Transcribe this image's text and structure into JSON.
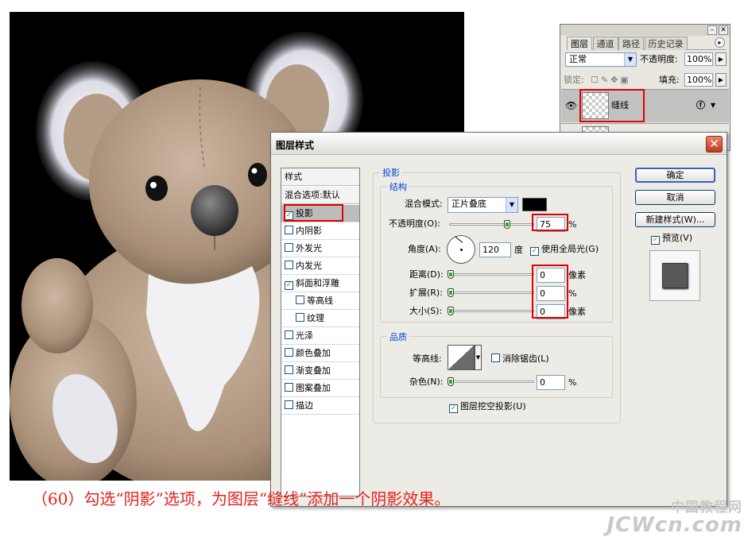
{
  "layers_panel": {
    "tabs": [
      {
        "label": "图层",
        "active": true
      },
      {
        "label": "通道"
      },
      {
        "label": "路径"
      },
      {
        "label": "历史记录"
      }
    ],
    "blend_mode": "正常",
    "opacity_label": "不透明度:",
    "opacity_value": "100%",
    "lock_label": "锁定:",
    "fill_label": "填充:",
    "fill_value": "100%",
    "layer_name": "缝线"
  },
  "dialog": {
    "title": "图层样式",
    "close_glyph": "✕",
    "style_list": [
      {
        "label": "样式",
        "header": true
      },
      {
        "label": "混合选项:默认",
        "header": true
      },
      {
        "label": "投影",
        "checked": true,
        "selected": true
      },
      {
        "label": "内阴影",
        "checked": false
      },
      {
        "label": "外发光",
        "checked": false
      },
      {
        "label": "内发光",
        "checked": false
      },
      {
        "label": "斜面和浮雕",
        "checked": true
      },
      {
        "label": "等高线",
        "checked": false,
        "indent": true
      },
      {
        "label": "纹理",
        "checked": false,
        "indent": true
      },
      {
        "label": "光泽",
        "checked": false
      },
      {
        "label": "颜色叠加",
        "checked": false
      },
      {
        "label": "渐变叠加",
        "checked": false
      },
      {
        "label": "图案叠加",
        "checked": false
      },
      {
        "label": "描边",
        "checked": false
      }
    ],
    "drop_shadow": {
      "title": "投影",
      "structure_title": "结构",
      "blend_mode_label": "混合模式:",
      "blend_mode_value": "正片叠底",
      "shadow_color": "#000000",
      "opacity_label": "不透明度(O):",
      "opacity_value": "75",
      "opacity_unit": "%",
      "angle_label": "角度(A):",
      "angle_value": "120",
      "angle_unit": "度",
      "global_light_label": "使用全局光(G)",
      "global_light_checked": true,
      "distance_label": "距离(D):",
      "distance_value": "0",
      "distance_unit": "像素",
      "spread_label": "扩展(R):",
      "spread_value": "0",
      "spread_unit": "%",
      "size_label": "大小(S):",
      "size_value": "0",
      "size_unit": "像素",
      "quality_title": "品质",
      "contour_label": "等高线:",
      "antialias_label": "消除锯齿(L)",
      "antialias_checked": false,
      "noise_label": "杂色(N):",
      "noise_value": "0",
      "noise_unit": "%",
      "knockout_label": "图层挖空投影(U)",
      "knockout_checked": true
    },
    "buttons": {
      "ok": "确定",
      "cancel": "取消",
      "new_style": "新建样式(W)...",
      "preview": "预览(V)",
      "preview_checked": true
    }
  },
  "caption": "（60）勾选“阴影”选项，为图层“缝线”添加一个阴影效果。",
  "watermark": {
    "cn": "中国教程网",
    "en": "JCWcn.com"
  },
  "colors": {
    "accent_red": "#e00000",
    "caption_red": "#e4221b",
    "group_title_blue": "#0046d5"
  }
}
